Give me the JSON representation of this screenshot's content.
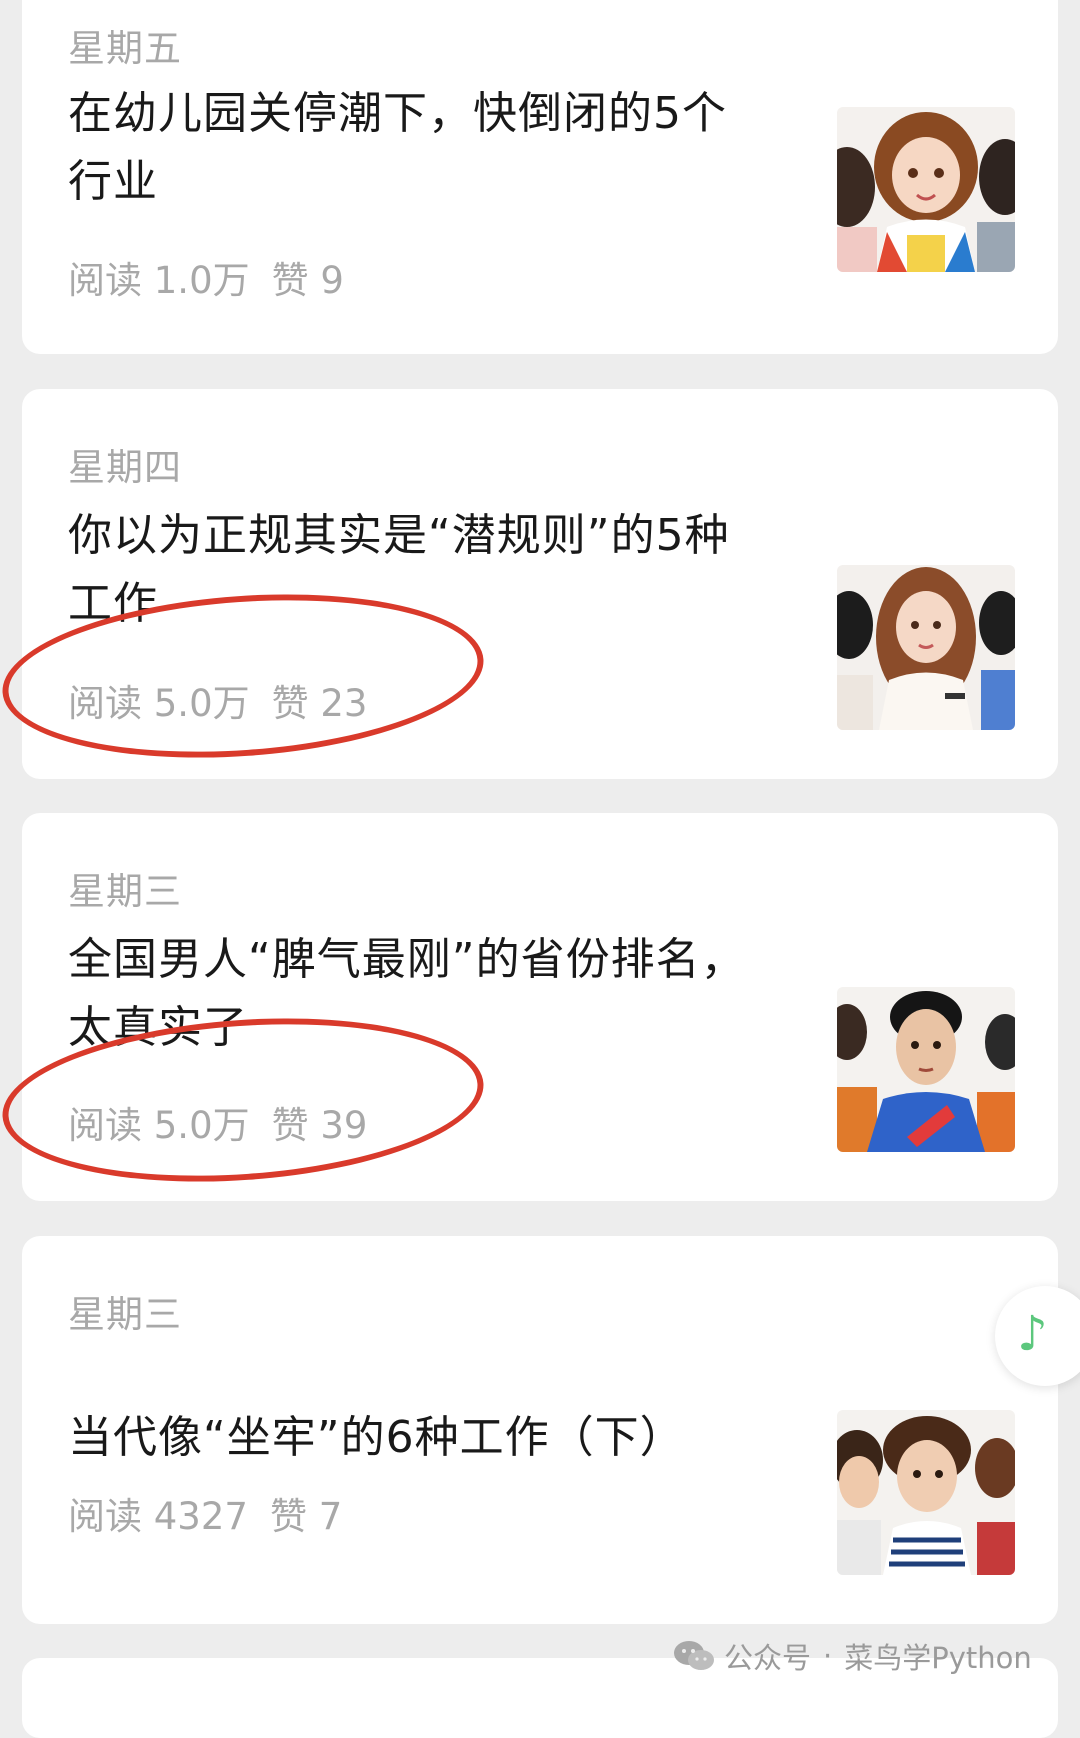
{
  "articles": [
    {
      "day": "星期五",
      "title_lines": [
        "在幼儿园关停潮下，快倒闭的5个",
        "行业"
      ],
      "reads": "阅读 1.0万",
      "likes": "赞 9"
    },
    {
      "day": "星期四",
      "title_lines": [
        "你以为正规其实是“潜规则”的5种",
        "工作"
      ],
      "reads": "阅读 5.0万",
      "likes": "赞 23"
    },
    {
      "day": "星期三",
      "title_lines": [
        "全国男人“脾气最刚”的省份排名，",
        "太真实了"
      ],
      "reads": "阅读 5.0万",
      "likes": "赞 39"
    },
    {
      "day": "星期三",
      "title_lines": [
        "当代像“坐牢”的6种工作（下）"
      ],
      "reads": "阅读 4327",
      "likes": "赞 7"
    }
  ],
  "music_button": {
    "icon": "music-note-icon",
    "glyph": "♪"
  },
  "watermark": {
    "icon": "wechat-icon",
    "account_type": "公众号",
    "separator": "·",
    "account_name": "菜鸟学Python"
  },
  "colors": {
    "background": "#ededed",
    "card": "#ffffff",
    "title": "#191919",
    "meta": "#a8a8a8",
    "annotation": "#d93a2b",
    "accent": "#5cc77d"
  }
}
